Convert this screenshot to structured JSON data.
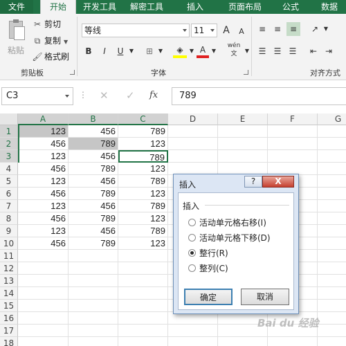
{
  "tabs": [
    "文件",
    "开始",
    "开发工具",
    "解密工具",
    "插入",
    "页面布局",
    "公式",
    "数据"
  ],
  "ribbon": {
    "paste": "粘贴",
    "cut": "剪切",
    "copy": "复制",
    "format_painter": "格式刷",
    "clipboard_group": "剪贴板",
    "font_name": "等线",
    "font_size": "11",
    "font_group": "字体",
    "align_group": "对齐方式",
    "bold": "B",
    "italic": "I",
    "underline": "U",
    "grow": "A",
    "shrink": "A",
    "font_color": "A",
    "phonetic": "wén"
  },
  "formula_bar": {
    "name_box": "C3",
    "fx": "fx",
    "value": "789"
  },
  "grid": {
    "columns": [
      "A",
      "B",
      "C",
      "D",
      "E",
      "F",
      "G"
    ],
    "rows": [
      [
        "123",
        "456",
        "789"
      ],
      [
        "456",
        "789",
        "123"
      ],
      [
        "123",
        "456",
        "789"
      ],
      [
        "456",
        "789",
        "123"
      ],
      [
        "123",
        "456",
        "789"
      ],
      [
        "456",
        "789",
        "123"
      ],
      [
        "123",
        "456",
        "789"
      ],
      [
        "456",
        "789",
        "123"
      ],
      [
        "123",
        "456",
        "789"
      ],
      [
        "456",
        "789",
        "123"
      ]
    ],
    "row_numbers": [
      "1",
      "2",
      "3",
      "4",
      "5",
      "6",
      "7",
      "8",
      "9",
      "10",
      "11",
      "12",
      "13",
      "14",
      "15",
      "16",
      "17",
      "18"
    ]
  },
  "dialog": {
    "title": "插入",
    "help": "?",
    "close": "X",
    "group": "插入",
    "options": [
      {
        "label": "活动单元格右移(I)",
        "checked": false
      },
      {
        "label": "活动单元格下移(D)",
        "checked": false
      },
      {
        "label": "整行(R)",
        "checked": true
      },
      {
        "label": "整列(C)",
        "checked": false
      }
    ],
    "ok": "确定",
    "cancel": "取消"
  },
  "watermark": "Bai du 经验",
  "colors": {
    "accent": "#217346",
    "dialog_bg": "#dce6f4",
    "selection": "#c6c6c6"
  }
}
